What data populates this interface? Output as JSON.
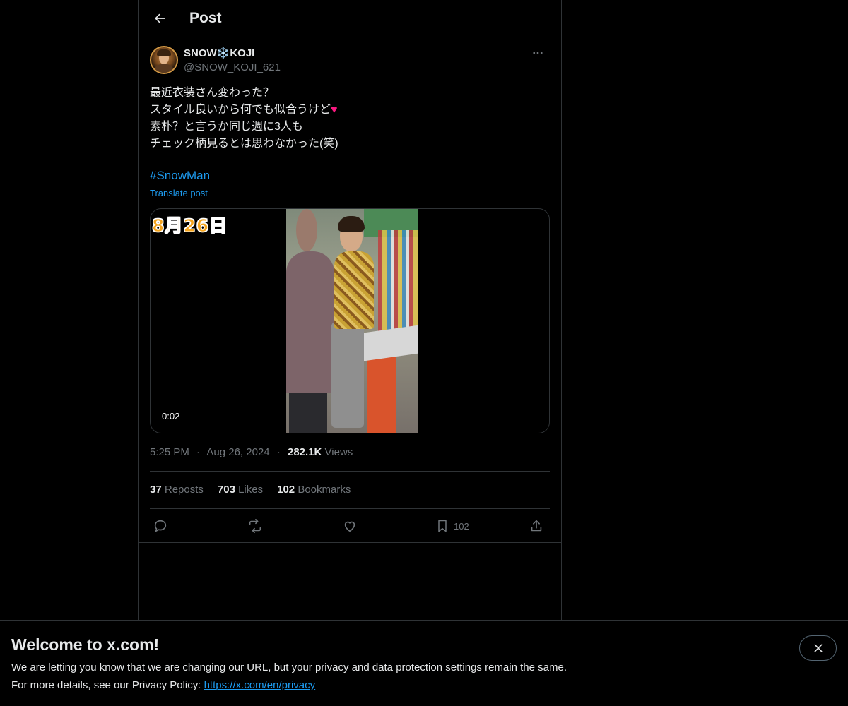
{
  "header": {
    "title": "Post"
  },
  "author": {
    "display_name": "SNOW❄️KOJI",
    "handle": "@SNOW_KOJI_621"
  },
  "tweet": {
    "lines": [
      "最近衣装さん変わった？",
      "スタイル良いから何でも似合うけど",
      "素朴？と言うか同じ週に3人も",
      "チェック柄見るとは思わなかった(笑)"
    ],
    "heart_emoji": "♥",
    "hashtag": "#SnowMan",
    "translate_label": "Translate post"
  },
  "media": {
    "overlay_date": "8月26日",
    "time": "0:02"
  },
  "meta": {
    "time": "5:25 PM",
    "date": "Aug 26, 2024",
    "views_count": "282.1K",
    "views_label": "Views",
    "dot": "·"
  },
  "stats": {
    "reposts_count": "37",
    "reposts_label": "Reposts",
    "likes_count": "703",
    "likes_label": "Likes",
    "bookmarks_count": "102",
    "bookmarks_label": "Bookmarks"
  },
  "actions": {
    "bookmark_count": "102"
  },
  "banner": {
    "title": "Welcome to x.com!",
    "line1": "We are letting you know that we are changing our URL, but your privacy and data protection settings remain the same.",
    "line2_prefix": "For more details, see our Privacy Policy: ",
    "link": "https://x.com/en/privacy"
  },
  "colors": {
    "background": "#000000",
    "text": "#e7e9ea",
    "muted": "#71767b",
    "accent": "#1d9bf0",
    "border": "#2f3336",
    "heart": "#f91880"
  }
}
